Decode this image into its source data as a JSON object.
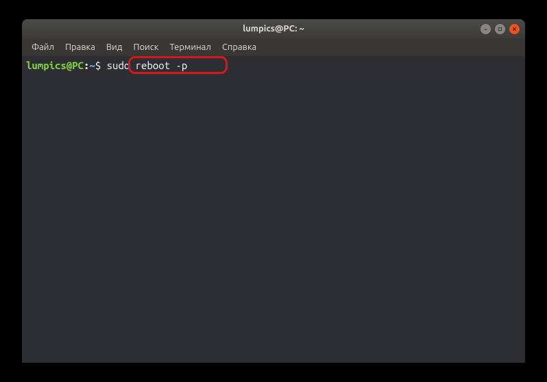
{
  "window": {
    "title": "lumpics@PC: ~"
  },
  "menubar": {
    "items": [
      "Файл",
      "Правка",
      "Вид",
      "Поиск",
      "Терминал",
      "Справка"
    ]
  },
  "terminal": {
    "prompt_user": "lumpics@PC",
    "prompt_colon": ":",
    "prompt_path": "~",
    "prompt_symbol": "$",
    "command": "sudo reboot -p"
  }
}
